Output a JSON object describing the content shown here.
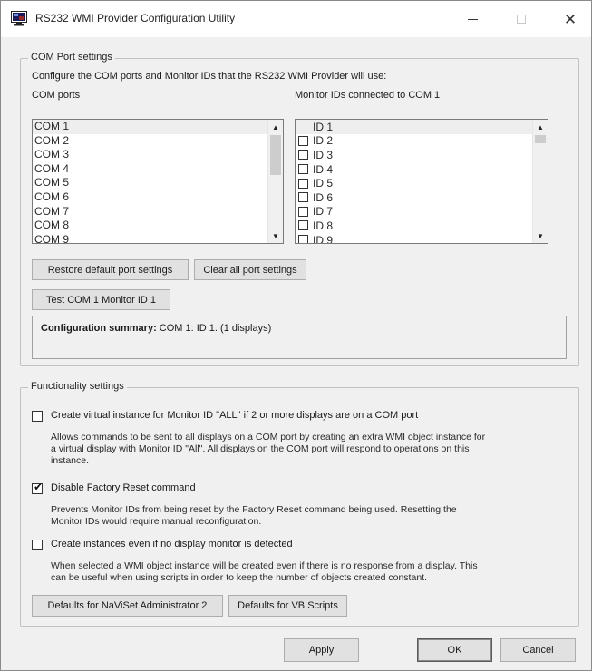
{
  "window": {
    "title": "RS232 WMI Provider Configuration Utility",
    "min_icon": "minimize-icon",
    "max_icon": "maximize-icon",
    "close_glyph": "✕"
  },
  "com_port_settings": {
    "group_label": "COM Port settings",
    "intro": "Configure the COM ports and Monitor IDs that the RS232 WMI Provider will use:",
    "com_ports_label": "COM ports",
    "monitor_ids_label": "Monitor IDs connected to COM 1",
    "com_ports": [
      "COM 1",
      "COM 2",
      "COM 3",
      "COM 4",
      "COM 5",
      "COM 6",
      "COM 7",
      "COM 8",
      "COM 9"
    ],
    "selected_com": "COM 1",
    "monitor_ids": [
      {
        "label": "ID 1",
        "checked": true
      },
      {
        "label": "ID 2",
        "checked": false
      },
      {
        "label": "ID 3",
        "checked": false
      },
      {
        "label": "ID 4",
        "checked": false
      },
      {
        "label": "ID 5",
        "checked": false
      },
      {
        "label": "ID 6",
        "checked": false
      },
      {
        "label": "ID 7",
        "checked": false
      },
      {
        "label": "ID 8",
        "checked": false
      },
      {
        "label": "ID 9",
        "checked": false
      }
    ],
    "restore_button": "Restore default port settings",
    "clear_button": "Clear all port settings",
    "test_button": "Test COM 1 Monitor ID 1",
    "summary_bold": "Configuration summary:",
    "summary_text": " COM 1: ID 1. (1 displays)"
  },
  "functionality_settings": {
    "group_label": "Functionality settings",
    "opt1_label": "Create virtual instance for Monitor ID \"ALL\" if 2 or more displays are on a COM port",
    "opt1_checked": false,
    "opt1_desc": [
      "Allows commands to be sent to all displays on a COM port by creating an extra WMI object instance for",
      "a virtual display with Monitor ID \"All\". All displays on the COM port will respond to operations on this",
      "instance."
    ],
    "opt2_label": "Disable Factory Reset command",
    "opt2_checked": true,
    "opt2_desc": [
      "Prevents Monitor IDs from being reset by the Factory Reset command being used. Resetting the",
      "Monitor IDs would require manual reconfiguration."
    ],
    "opt3_label": "Create instances even if no display monitor is detected",
    "opt3_checked": false,
    "opt3_desc": [
      "When selected a WMI object instance will be created even if there is no response from a display. This",
      "can be useful when using scripts in order to keep the number of objects created constant."
    ],
    "naviset_button": "Defaults for NaViSet Administrator 2",
    "vb_button": "Defaults for VB Scripts"
  },
  "footer": {
    "apply": "Apply",
    "ok": "OK",
    "cancel": "Cancel"
  },
  "check_glyph": "✔"
}
